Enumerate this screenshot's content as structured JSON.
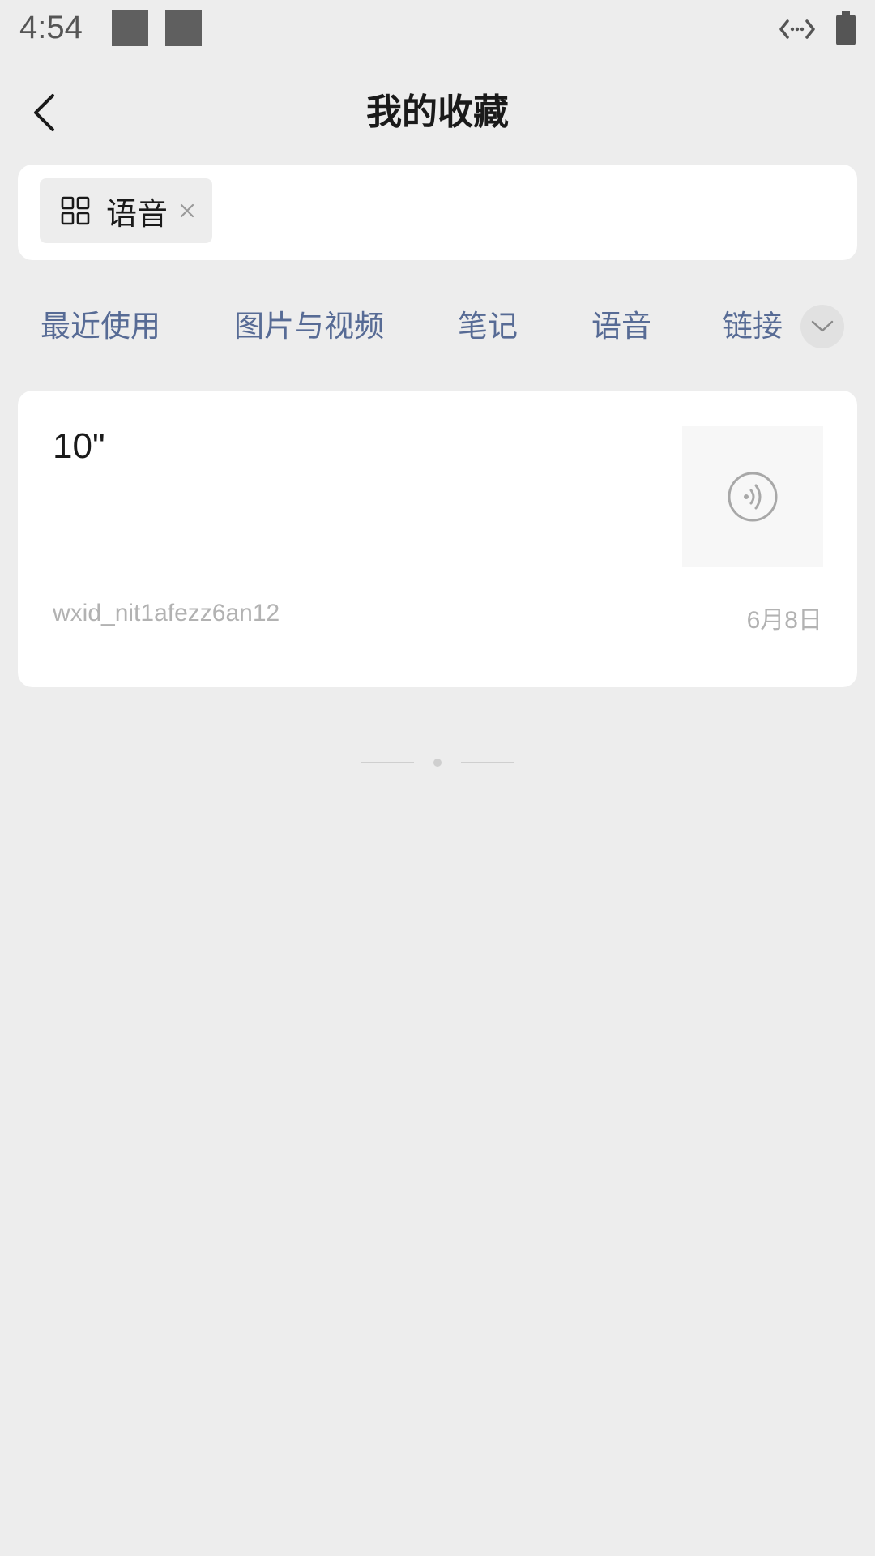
{
  "status_bar": {
    "time": "4:54"
  },
  "nav": {
    "back_icon": "chevron-left-icon",
    "title": "我的收藏"
  },
  "search": {
    "chip_icon": "grid-icon",
    "chip_label": "语音",
    "chip_close_icon": "close-icon"
  },
  "tabs": [
    {
      "label": "最近使用"
    },
    {
      "label": "图片与视频"
    },
    {
      "label": "笔记"
    },
    {
      "label": "语音"
    },
    {
      "label": "链接"
    }
  ],
  "tabs_more_icon": "chevron-down-icon",
  "items": [
    {
      "duration": "10\"",
      "thumb_icon": "voice-icon",
      "source": "wxid_nit1afezz6an12",
      "date": "6月8日"
    }
  ],
  "colors": {
    "background": "#ededed",
    "card": "#ffffff",
    "link_blue": "#576b95",
    "meta_gray": "#b2b2b2"
  }
}
